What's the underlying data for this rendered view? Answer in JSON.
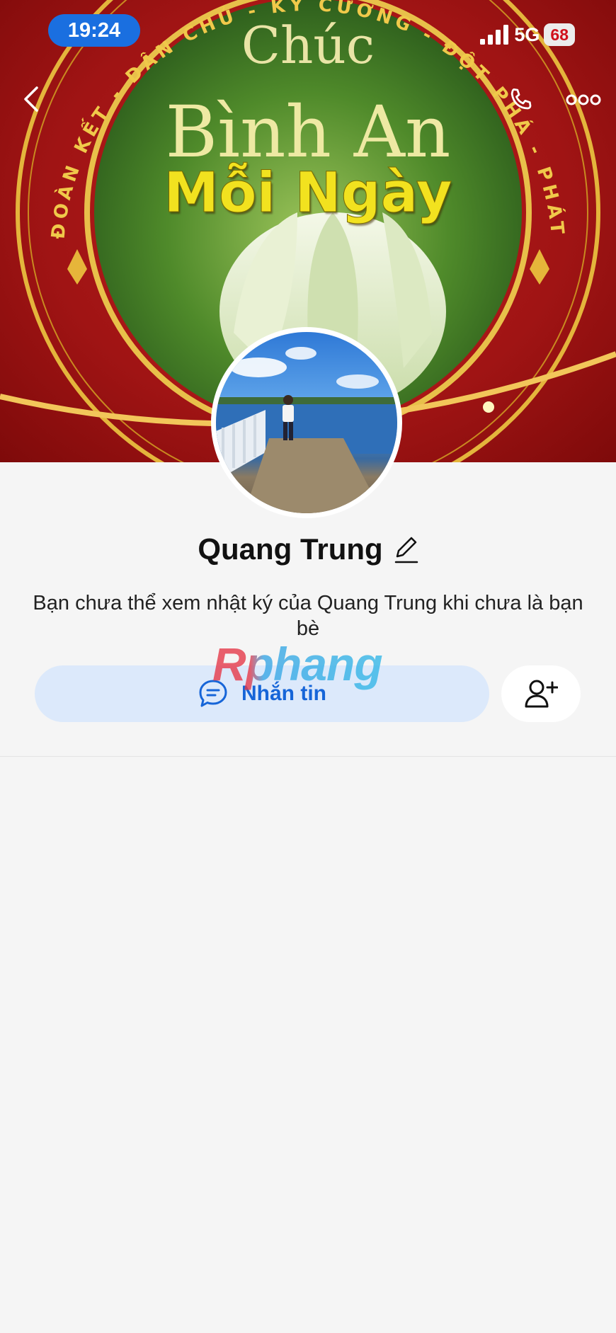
{
  "status_bar": {
    "time": "19:24",
    "network": "5G",
    "battery": "68"
  },
  "cover": {
    "line1": "Chúc",
    "line2": "Bình An",
    "line3": "Mỗi Ngày",
    "ring_text": "ĐOÀN KẾT - DÂN CHỦ - KỶ CƯƠNG - ĐỘT PHÁ - PHÁT TRIỂN"
  },
  "profile": {
    "name": "Quang Trung",
    "notice": "Bạn chưa thể xem nhật ký của Quang Trung khi chưa là bạn bè"
  },
  "actions": {
    "message_label": "Nhắn tin"
  },
  "watermark": "Rphang",
  "icons": {
    "back": "chevron-left-icon",
    "call": "phone-icon",
    "more": "more-dots-icon",
    "edit": "pencil-icon",
    "message": "chat-bubble-icon",
    "add_friend": "add-friend-icon"
  },
  "colors": {
    "status_pill": "#1a6fe0",
    "message_button_bg": "#dce9fb",
    "message_button_text": "#1665d8",
    "page_bg": "#f5f5f5",
    "cover_red": "#a01414"
  }
}
